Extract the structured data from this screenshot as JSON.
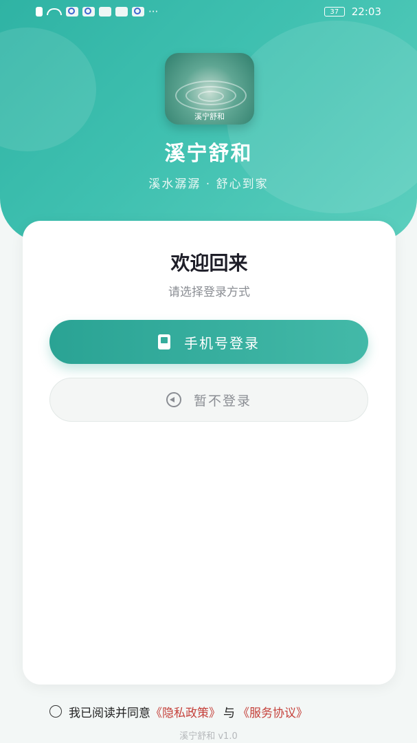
{
  "status_bar": {
    "time": "22:03",
    "battery": "37",
    "more": "···"
  },
  "app": {
    "name": "溪宁舒和",
    "slogan": "溪水潺潺 · 舒心到家",
    "icon_label": "溪宁舒和"
  },
  "card": {
    "welcome": "欢迎回来",
    "subtitle": "请选择登录方式",
    "phone_login_label": "手机号登录",
    "skip_login_label": "暂不登录"
  },
  "agreement": {
    "prefix": "我已阅读并同意",
    "privacy_link": "《隐私政策》",
    "connector": "与",
    "service_link": "《服务协议》"
  },
  "version": "溪宁舒和 v1.0",
  "colors": {
    "brand": "#2fb3a4",
    "link": "#c5413b"
  },
  "icons": {
    "phone_login": "phone-icon",
    "skip_login": "back-arrow-circle-icon"
  }
}
